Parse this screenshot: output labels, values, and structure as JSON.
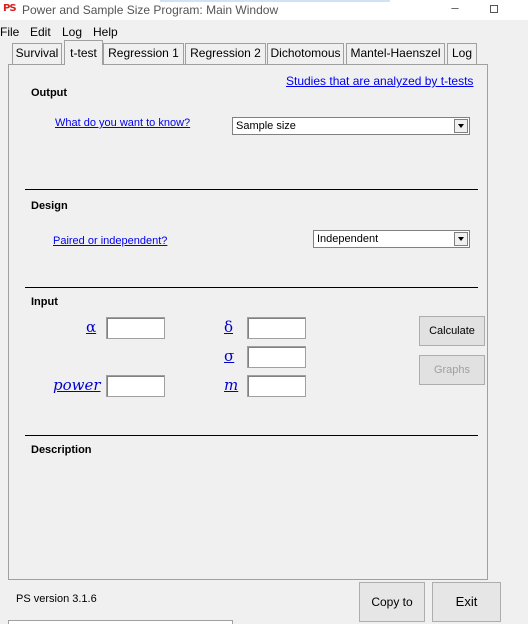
{
  "window": {
    "icon_text_red": "PS",
    "title": "Power and Sample Size Program:  Main Window",
    "minimize_glyph": "–"
  },
  "menu": [
    "File",
    "Edit",
    "Log",
    "Help"
  ],
  "tabs": [
    {
      "label": "Survival"
    },
    {
      "label": "t-test"
    },
    {
      "label": "Regression 1"
    },
    {
      "label": "Regression 2"
    },
    {
      "label": "Dichotomous"
    },
    {
      "label": "Mantel-Haenszel"
    },
    {
      "label": "Log"
    }
  ],
  "active_tab": "t-test",
  "studies_link": "Studies that are analyzed by t-tests",
  "output": {
    "heading": "Output",
    "question_link": "What do you want to know?",
    "selected": "Sample size"
  },
  "design": {
    "heading": "Design",
    "question_link": "Paired or independent?",
    "selected": "Independent"
  },
  "input": {
    "heading": "Input",
    "alpha": {
      "symbol": "α",
      "value": ""
    },
    "delta": {
      "symbol": "δ",
      "value": ""
    },
    "sigma": {
      "symbol": "σ",
      "value": ""
    },
    "power": {
      "symbol": "power",
      "value": ""
    },
    "m": {
      "symbol": "m",
      "value": ""
    },
    "calculate_label": "Calculate",
    "graphs_label": "Graphs"
  },
  "description": {
    "heading": "Description"
  },
  "footer": {
    "version": "PS version 3.1.6",
    "copy_to_log_label": "Copy to Log",
    "exit_label": "Exit"
  }
}
